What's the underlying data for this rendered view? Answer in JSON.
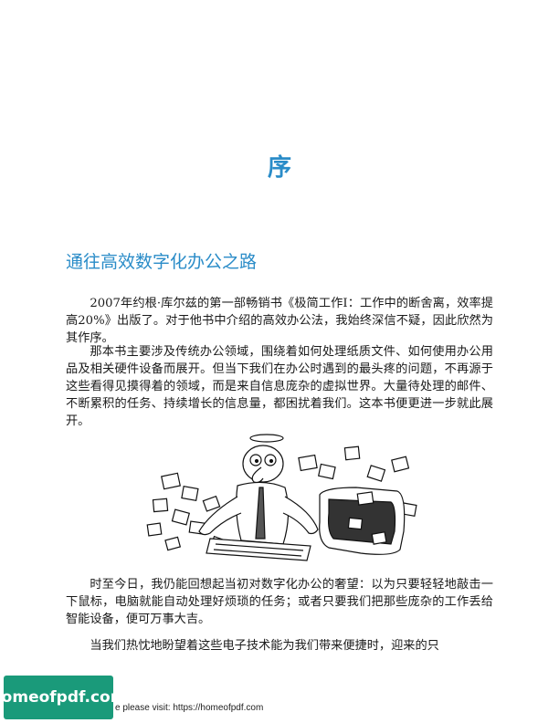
{
  "chapter": {
    "title": "序"
  },
  "section": {
    "title": "通往高效数字化办公之路"
  },
  "paragraphs": [
    "2007年约根·库尔兹的第一部畅销书《极简工作Ⅰ：工作中的断舍离，效率提高20%》出版了。对于他书中介绍的高效办公法，我始终深信不疑，因此欣然为其作序。",
    "那本书主要涉及传统办公领域，围绕着如何处理纸质文件、如何使用办公用品及相关硬件设备而展开。但当下我们在办公时遇到的最头疼的问题，不再源于这些看得见摸得着的领域，而是来自信息庞杂的虚拟世界。大量待处理的邮件、不断累积的任务、持续增长的信息量，都困扰着我们。这本书便更进一步就此展开。",
    "时至今日，我仍能回想起当初对数字化办公的奢望：以为只要轻轻地敲击一下鼠标，电脑就能自动处理好烦琐的任务；或者只要我们把那些庞杂的工作丢给智能设备，便可万事大吉。",
    "当我们热忱地盼望着这些电子技术能为我们带来便捷时，迎来的只"
  ],
  "watermark": {
    "text": "homeofpdf.com"
  },
  "footer": {
    "note": "e please visit: https://homeofpdf.com"
  }
}
